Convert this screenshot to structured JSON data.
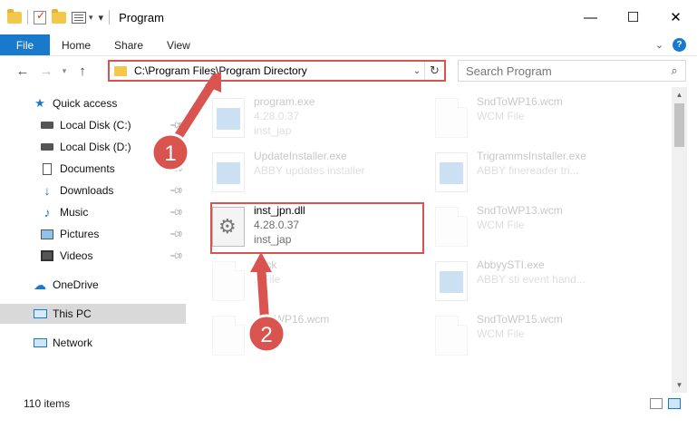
{
  "window": {
    "title": "Program",
    "minimize_glyph": "—",
    "maximize_glyph": "☐",
    "close_glyph": "✕"
  },
  "ribbon": {
    "file_tab": "File",
    "tabs": [
      "Home",
      "Share",
      "View"
    ],
    "help_glyph": "?"
  },
  "address": {
    "path": "C:\\Program Files\\Program Directory",
    "search_placeholder": "Search Program"
  },
  "sidebar": {
    "items": [
      {
        "label": "Quick access",
        "icon": "star-icon"
      },
      {
        "label": "Local Disk (C:)",
        "icon": "disk-icon",
        "pinned": true
      },
      {
        "label": "Local Disk (D:)",
        "icon": "disk-icon",
        "pinned": true
      },
      {
        "label": "Documents",
        "icon": "document-icon",
        "pinned": true
      },
      {
        "label": "Downloads",
        "icon": "download-icon",
        "pinned": true
      },
      {
        "label": "Music",
        "icon": "music-icon",
        "pinned": true
      },
      {
        "label": "Pictures",
        "icon": "picture-icon",
        "pinned": true
      },
      {
        "label": "Videos",
        "icon": "video-icon",
        "pinned": true
      },
      {
        "label": "OneDrive",
        "icon": "cloud-icon"
      },
      {
        "label": "This PC",
        "icon": "computer-icon",
        "selected": true
      },
      {
        "label": "Network",
        "icon": "network-icon"
      }
    ]
  },
  "files": [
    {
      "name": "program.exe",
      "line2": "4.28.0.37",
      "line3": "inst_jap",
      "icon": "exe-icon"
    },
    {
      "name": "SndToWP16.wcm",
      "line2": "WCM File",
      "line3": "",
      "icon": "blank-file-icon"
    },
    {
      "name": "UpdateInstaller.exe",
      "line2": "ABBY updates installer",
      "line3": "",
      "icon": "exe-icon"
    },
    {
      "name": "TrigrammsInstaller.exe",
      "line2": "ABBY finereader tri...",
      "line3": "",
      "icon": "exe-icon"
    },
    {
      "name": "inst_jpn.dll",
      "line2": "4.28.0.37",
      "line3": "inst_jap",
      "icon": "dll-gear-icon",
      "highlighted": true
    },
    {
      "name": "SndToWP13.wcm",
      "line2": "WCM File",
      "line3": "",
      "icon": "blank-file-icon"
    },
    {
      "name": "....ck",
      "line2": "...File",
      "line3": "",
      "icon": "blank-file-icon"
    },
    {
      "name": "AbbyySTI.exe",
      "line2": "ABBY sti event hand...",
      "line3": "",
      "icon": "exe-icon"
    },
    {
      "name": "...ToWP16.wcm",
      "line2": "...ile",
      "line3": "",
      "icon": "blank-file-icon"
    },
    {
      "name": "SndToWP15.wcm",
      "line2": "WCM File",
      "line3": "",
      "icon": "blank-file-icon"
    }
  ],
  "status": {
    "item_count": "110 items"
  },
  "annotations": {
    "step1": "1",
    "step2": "2",
    "color": "#d9534f"
  }
}
